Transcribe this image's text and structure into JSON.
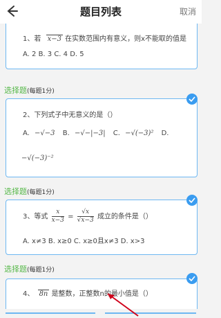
{
  "header": {
    "title": "题目列表",
    "cancel_label": "取消"
  },
  "questions": [
    {
      "text_before": "1、若",
      "radicand": "x−3",
      "text_after": "在实数范围内有意义，则x不能取的值是",
      "options_line": "A. 2 B. 3 C. 4 D. 5"
    },
    {
      "section_label": "选择题",
      "section_score": "(每题1分)",
      "text": "2、下列式子中无意义的是（）",
      "opt_a": "A.",
      "opt_a_expr": "−√−3",
      "opt_b": "B.",
      "opt_b_expr": "−√−|−3|",
      "opt_c": "C.",
      "opt_c_expr": "−√(−3)²",
      "opt_d": "D.",
      "opt_d_expr": "−√(−3)⁻²"
    },
    {
      "section_label": "选择题",
      "section_score": "(每题1分)",
      "text_before": "3、等式",
      "lhs_num": "x",
      "lhs_den": "x−3",
      "rhs_num": "√x",
      "rhs_den": "√x−3",
      "text_after": "成立的条件是（）",
      "options_line": "A. x≠3 B. x≥0 C. x≥0且x≠3 D. x>3"
    },
    {
      "section_label": "选择题",
      "section_score": "(每题1分)",
      "text_before": "4、",
      "radicand": "8n",
      "text_after": "是整数，正整数n的最小值是（）"
    }
  ],
  "colors": {
    "accent": "#3a9cf0",
    "card_border": "#6db7f2",
    "section_green": "#57b84a",
    "annotation_arrow": "#d0021b"
  }
}
